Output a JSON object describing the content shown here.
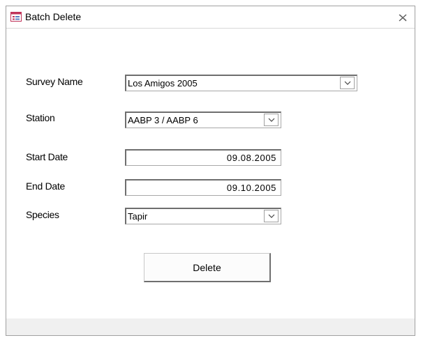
{
  "window": {
    "title": "Batch Delete"
  },
  "form": {
    "survey_name": {
      "label": "Survey Name",
      "value": "Los Amigos 2005"
    },
    "station": {
      "label": "Station",
      "value": "AABP 3 / AABP 6"
    },
    "start_date": {
      "label": "Start Date",
      "value": "09.08.2005"
    },
    "end_date": {
      "label": "End Date",
      "value": "09.10.2005"
    },
    "species": {
      "label": "Species",
      "value": "Tapir"
    }
  },
  "actions": {
    "delete_label": "Delete"
  },
  "icons": {
    "form": "form-icon",
    "close": "close-icon",
    "dropdown": "chevron-down-icon"
  },
  "colors": {
    "icon_accent": "#c0345a"
  }
}
